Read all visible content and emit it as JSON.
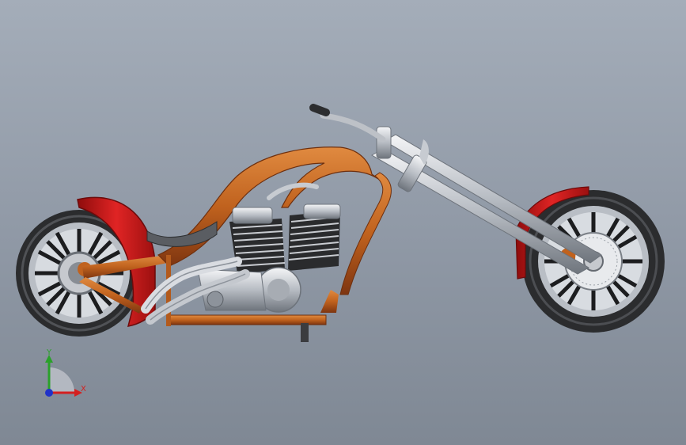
{
  "viewport": {
    "background_top": "#a4adb9",
    "background_bottom": "#7f8894"
  },
  "model": {
    "colors": {
      "frame_orange": "#c0621e",
      "frame_dark": "#8a3d10",
      "fender_red": "#d11a1a",
      "chrome": "#d6d9de",
      "chrome_dark": "#8d939b",
      "tire": "#2e2f31",
      "spoke": "#1e1f21"
    }
  },
  "triad": {
    "x_label": "X",
    "y_label": "Y",
    "x_color": "#d42020",
    "y_color": "#2aa12a",
    "z_color": "#2032c8"
  }
}
